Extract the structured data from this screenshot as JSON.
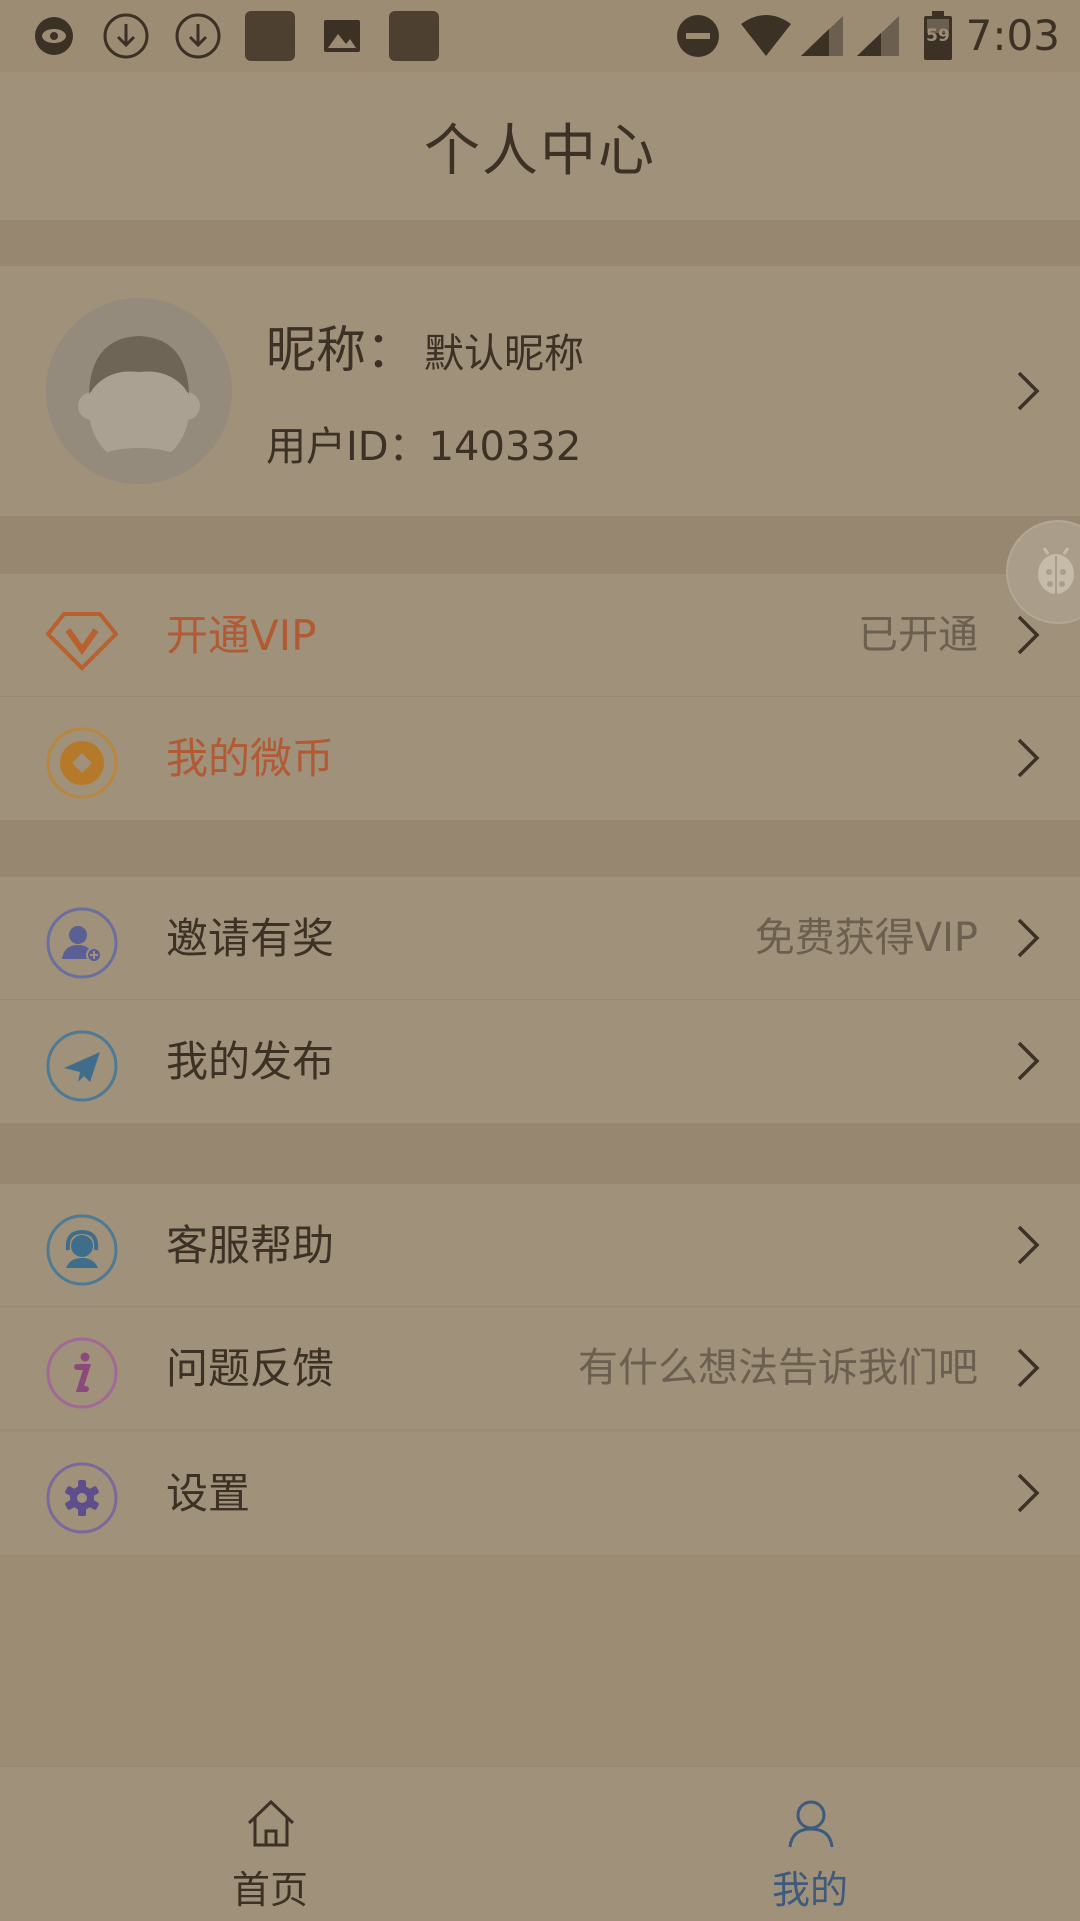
{
  "status_bar": {
    "time": "7:03",
    "battery_level": "59",
    "icons": [
      "eye-icon",
      "download-icon",
      "download-icon",
      "app-icon",
      "image-icon",
      "app-icon",
      "do-not-disturb-icon",
      "wifi-icon",
      "signal-icon",
      "signal-icon",
      "battery-icon"
    ]
  },
  "header": {
    "title": "个人中心"
  },
  "profile": {
    "nickname_label": "昵称：",
    "nickname_value": "默认昵称",
    "user_id_label": "用户ID：",
    "user_id_value": "140332"
  },
  "menu": {
    "vip": {
      "label": "开通VIP",
      "value": "已开通",
      "icon": "vip-diamond-icon"
    },
    "coins": {
      "label": "我的微币",
      "value": "",
      "icon": "coin-icon"
    },
    "invite": {
      "label": "邀请有奖",
      "value": "免费获得VIP",
      "icon": "invite-user-icon"
    },
    "publish": {
      "label": "我的发布",
      "value": "",
      "icon": "paper-plane-icon"
    },
    "support": {
      "label": "客服帮助",
      "value": "",
      "icon": "customer-service-icon"
    },
    "feedback": {
      "label": "问题反馈",
      "value": "有什么想法告诉我们吧",
      "icon": "info-icon"
    },
    "settings": {
      "label": "设置",
      "value": "",
      "icon": "gear-icon"
    }
  },
  "tabs": {
    "home": {
      "label": "首页",
      "icon": "home-icon"
    },
    "mine": {
      "label": "我的",
      "icon": "user-icon",
      "active": true
    }
  },
  "colors": {
    "overlay_bg": "#9c8c74",
    "row_bg": "#a0917a",
    "accent_red": "#b15a34",
    "active_tab": "#3e5a7c"
  }
}
